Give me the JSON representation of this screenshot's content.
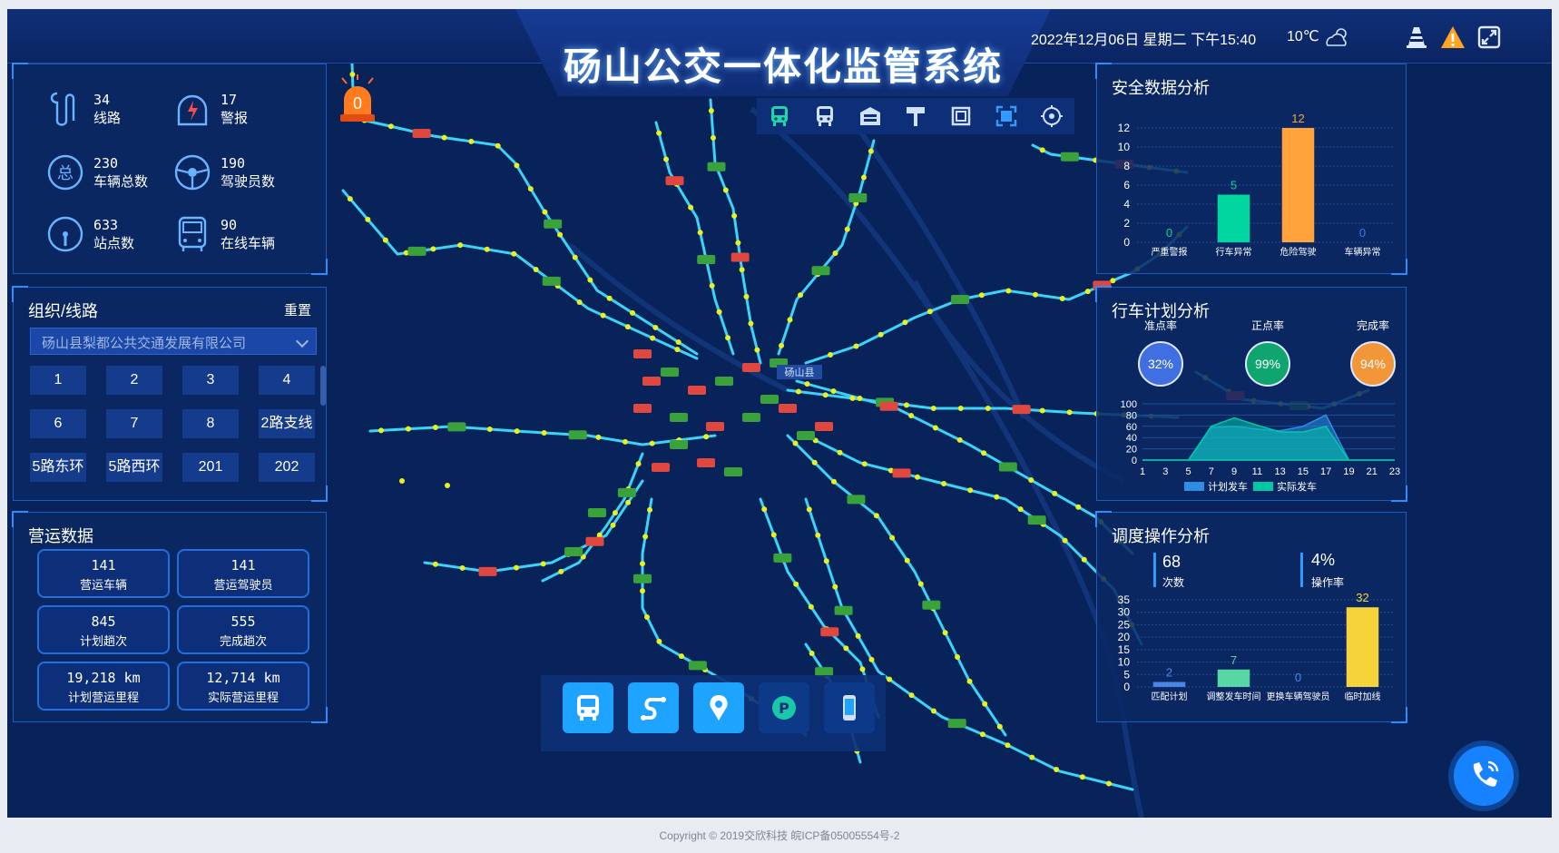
{
  "header": {
    "title": "砀山公交一体化监管系统",
    "datetime": "2022年12月06日  星期二  下午15:40",
    "temperature": "10℃",
    "weather_icon": "partly-cloudy-icon",
    "icons": [
      "traffic-cone-icon",
      "warning-icon",
      "fullscreen-icon"
    ],
    "warning_color": "#ffa51f"
  },
  "alarm": {
    "count": "0"
  },
  "summary": {
    "items": [
      {
        "num": "34",
        "label": "线路",
        "icon": "route-icon"
      },
      {
        "num": "17",
        "label": "警报",
        "icon": "alarm-icon"
      },
      {
        "num": "230",
        "label": "车辆总数",
        "icon": "total-icon",
        "glyph": "总"
      },
      {
        "num": "190",
        "label": "驾驶员数",
        "icon": "steering-wheel-icon"
      },
      {
        "num": "633",
        "label": "站点数",
        "icon": "gauge-icon"
      },
      {
        "num": "90",
        "label": "在线车辆",
        "icon": "bus-icon"
      }
    ]
  },
  "org": {
    "title": "组织/线路",
    "reset": "重置",
    "selected": "砀山县梨都公共交通发展有限公司",
    "routes": [
      "1",
      "2",
      "3",
      "4",
      "6",
      "7",
      "8",
      "2路支线",
      "5路东环",
      "5路西环",
      "201",
      "202"
    ]
  },
  "operations": {
    "title": "营运数据",
    "items": [
      {
        "value": "141",
        "label": "营运车辆"
      },
      {
        "value": "141",
        "label": "营运驾驶员"
      },
      {
        "value": "845",
        "label": "计划趟次"
      },
      {
        "value": "555",
        "label": "完成趟次"
      },
      {
        "value": "19,218 km",
        "label": "计划营运里程"
      },
      {
        "value": "12,714 km",
        "label": "实际营运里程"
      }
    ]
  },
  "map": {
    "toolbar_icons": [
      "bus-front-icon",
      "bus-side-icon",
      "garage-icon",
      "bus-stop-sign-icon",
      "frame-icon",
      "fullscreen-select-icon",
      "locate-icon"
    ],
    "bottom_buttons": [
      "bus-button-icon",
      "route-button-icon",
      "location-pin-icon",
      "parking-icon",
      "mobile-icon"
    ],
    "label": "砀山县",
    "line_color": "#3ad4f6",
    "stop_color": "#e8f11e",
    "online_bus_color": "#3aa23a",
    "alert_bus_color": "#e0473f"
  },
  "safety": {
    "title": "安全数据分析",
    "chart_data": {
      "type": "bar",
      "categories": [
        "严重警报",
        "行车异常",
        "危险驾驶",
        "车辆异常"
      ],
      "values": [
        0,
        5,
        12,
        0
      ],
      "ylim": [
        0,
        12
      ],
      "yticks": [
        0,
        2,
        4,
        6,
        8,
        10,
        12
      ],
      "colors": [
        "#00d7a0",
        "#00d7a0",
        "#ffa33a",
        "#2e7cf6"
      ]
    }
  },
  "plan": {
    "title": "行车计划分析",
    "rates": [
      {
        "label": "准点率",
        "value": "32%",
        "color": "#3f6fe0"
      },
      {
        "label": "正点率",
        "value": "99%",
        "color": "#0fa56f"
      },
      {
        "label": "完成率",
        "value": "94%",
        "color": "#f2963a"
      }
    ],
    "chart_data": {
      "type": "area",
      "x": [
        1,
        3,
        5,
        7,
        9,
        11,
        13,
        15,
        17,
        19,
        21,
        23
      ],
      "ylim": [
        0,
        100
      ],
      "yticks": [
        0,
        20,
        40,
        60,
        80,
        100
      ],
      "series": [
        {
          "name": "计划发车",
          "color": "#2e8ee6",
          "values": [
            0,
            0,
            0,
            58,
            60,
            55,
            52,
            60,
            80,
            0,
            0,
            0
          ]
        },
        {
          "name": "实际发车",
          "color": "#00c9a7",
          "values": [
            0,
            0,
            0,
            60,
            75,
            62,
            50,
            50,
            60,
            0,
            0,
            0
          ]
        }
      ]
    }
  },
  "dispatch": {
    "title": "调度操作分析",
    "count": "68",
    "count_label": "次数",
    "rate": "4%",
    "rate_label": "操作率",
    "chart_data": {
      "type": "bar",
      "categories": [
        "匹配计划",
        "调整发车时间",
        "更换车辆驾驶员",
        "临时加线"
      ],
      "values": [
        2,
        7,
        0,
        32
      ],
      "ylim": [
        0,
        35
      ],
      "yticks": [
        0,
        5,
        10,
        15,
        20,
        25,
        30,
        35
      ],
      "colors": [
        "#4a86e8",
        "#58d6a4",
        "#4a86e8",
        "#f7d33a"
      ]
    }
  },
  "footer": {
    "text": "Copyright © 2019交欣科技 皖ICP备05005554号-2"
  }
}
